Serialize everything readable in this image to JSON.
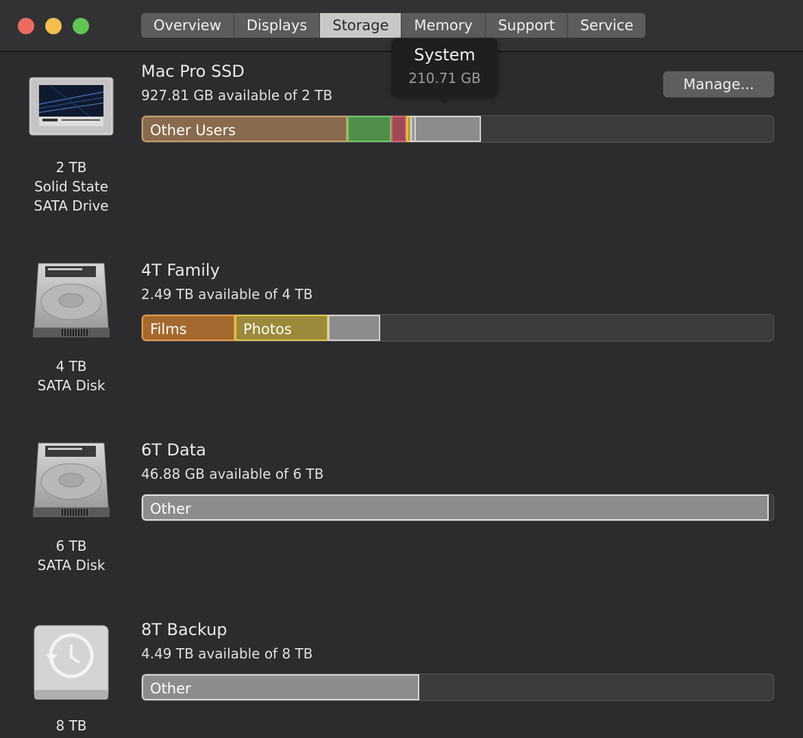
{
  "window": {
    "tabs": [
      {
        "label": "Overview"
      },
      {
        "label": "Displays"
      },
      {
        "label": "Storage"
      },
      {
        "label": "Memory"
      },
      {
        "label": "Support"
      },
      {
        "label": "Service"
      }
    ],
    "active_tab": "Storage"
  },
  "tooltip": {
    "title": "System",
    "value": "210.71 GB"
  },
  "manage_button": {
    "label": "Manage..."
  },
  "drives": [
    {
      "caption": [
        "2 TB",
        "Solid State",
        "SATA Drive"
      ],
      "icon": "ssd-icon",
      "volume_name": "Mac Pro SSD",
      "available": "927.81 GB available of 2 TB",
      "segments": [
        {
          "label": "Other Users",
          "color": "#8a6a4c",
          "border": "#c9a06a",
          "fraction": 0.325
        },
        {
          "label": "",
          "color": "#4f8f4a",
          "border": "#6ec766",
          "fraction": 0.069
        },
        {
          "label": "",
          "color": "#9e4a55",
          "border": "#e0606e",
          "fraction": 0.024
        },
        {
          "label": "",
          "color": "#b9a13c",
          "border": "#e8cf48",
          "fraction": 0.006
        },
        {
          "label": "",
          "color": "#9a9a9a",
          "border": "#dddddd",
          "fraction": 0.006
        },
        {
          "label": "",
          "color": "#8c8c8c",
          "border": "#d2d2d2",
          "fraction": 0.105
        }
      ]
    },
    {
      "caption": [
        "4 TB",
        "SATA Disk"
      ],
      "icon": "hard-disk-icon",
      "volume_name": "4T Family",
      "available": "2.49 TB available of 4 TB",
      "segments": [
        {
          "label": "Films",
          "color": "#a4692e",
          "border": "#e89a44",
          "fraction": 0.148
        },
        {
          "label": "Photos",
          "color": "#9a8a3a",
          "border": "#e1c84a",
          "fraction": 0.148
        },
        {
          "label": "",
          "color": "#8c8c8c",
          "border": "#d2d2d2",
          "fraction": 0.082
        }
      ]
    },
    {
      "caption": [
        "6 TB",
        "SATA Disk"
      ],
      "icon": "hard-disk-icon",
      "volume_name": "6T Data",
      "available": "46.88 GB available of 6 TB",
      "segments": [
        {
          "label": "Other",
          "color": "#8c8c8c",
          "border": "#e0e0e0",
          "fraction": 0.992
        }
      ]
    },
    {
      "caption": [
        "8 TB"
      ],
      "icon": "time-machine-disk-icon",
      "volume_name": "8T Backup",
      "available": "4.49 TB available of 8 TB",
      "segments": [
        {
          "label": "Other",
          "color": "#8c8c8c",
          "border": "#d8d8d8",
          "fraction": 0.439
        }
      ]
    }
  ]
}
